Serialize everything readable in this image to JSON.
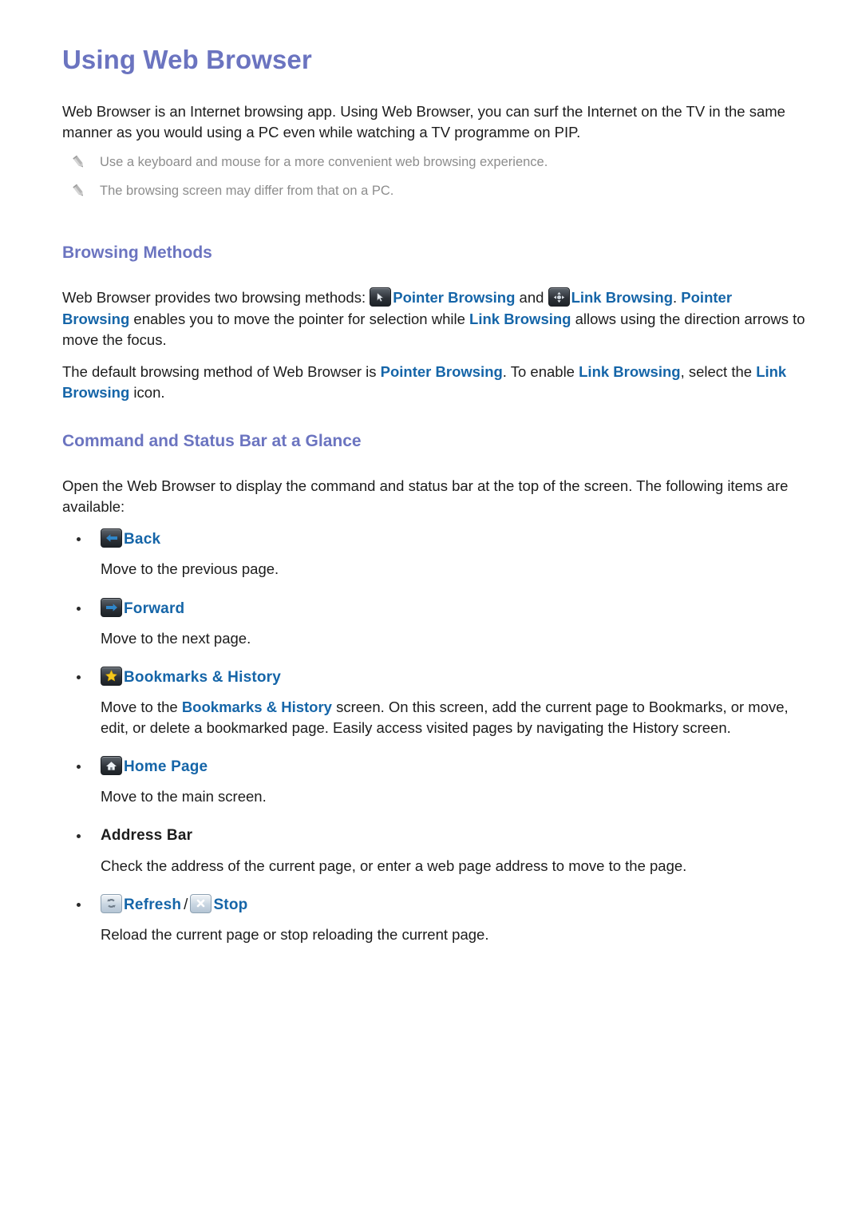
{
  "document": {
    "title": "Using Web Browser",
    "intro": "Web Browser is an Internet browsing app. Using Web Browser, you can surf the Internet on the TV in the same manner as you would using a PC even while watching a TV programme on PIP.",
    "notes": [
      {
        "icon": "pencil-icon",
        "text": "Use a keyboard and mouse for a more convenient web browsing experience."
      },
      {
        "icon": "pencil-icon",
        "text": "The browsing screen may differ from that on a PC."
      }
    ]
  },
  "browsing_methods": {
    "heading": "Browsing Methods",
    "paragraph1": {
      "p1": "Web Browser provides two browsing methods:",
      "pointer_icon": "mouse-pointer-icon",
      "link1": "Pointer Browsing",
      "p2": "and",
      "link_icon": "direction-arrows-icon",
      "link2": "Link Browsing",
      "p3": ".",
      "link3": "Pointer Browsing",
      "p4": "enables you to move the pointer for selection while",
      "link4": "Link Browsing",
      "p5": "allows using the direction arrows to move the focus."
    },
    "paragraph2": {
      "p1": "The default browsing method of Web Browser is",
      "link1": "Pointer Browsing",
      "p2": ". To enable",
      "link2": "Link Browsing",
      "p3": ", select the",
      "link3": "Link Browsing",
      "p4": "icon."
    }
  },
  "command_status_bar": {
    "heading": "Command and Status Bar at a Glance",
    "intro": "Open the Web Browser to display the command and status bar at the top of the screen. The following items are available:",
    "items": [
      {
        "icon": "back-arrow-icon",
        "label": "Back",
        "description": "Move to the previous page."
      },
      {
        "icon": "forward-arrow-icon",
        "label": "Forward",
        "description": "Move to the next page."
      },
      {
        "icon": "star-bookmark-icon",
        "label": "Bookmarks & History",
        "description_parts": {
          "p1": "Move to the",
          "link1": "Bookmarks & History",
          "p2": "screen. On this screen, add the current page to Bookmarks, or move, edit, or delete a bookmarked page. Easily access visited pages by navigating the History screen."
        }
      },
      {
        "icon": "home-house-icon",
        "label": "Home Page",
        "description": "Move to the main screen."
      },
      {
        "icon": null,
        "label": "Address Bar",
        "description": "Check the address of the current page, or enter a web page address to move to the page."
      },
      {
        "icon": "refresh-icon",
        "label": "Refresh",
        "separator": "/",
        "icon2": "stop-x-icon",
        "label2": "Stop",
        "description": "Reload the current page or stop reloading the current page."
      }
    ]
  },
  "colors": {
    "heading_purple": "#6b74c0",
    "link_blue": "#1565a8",
    "body_text": "#1c1c1c",
    "note_gray": "#8d8d8d",
    "star_yellow": "#f2c21a",
    "arrow_blue": "#2c7fc4"
  }
}
